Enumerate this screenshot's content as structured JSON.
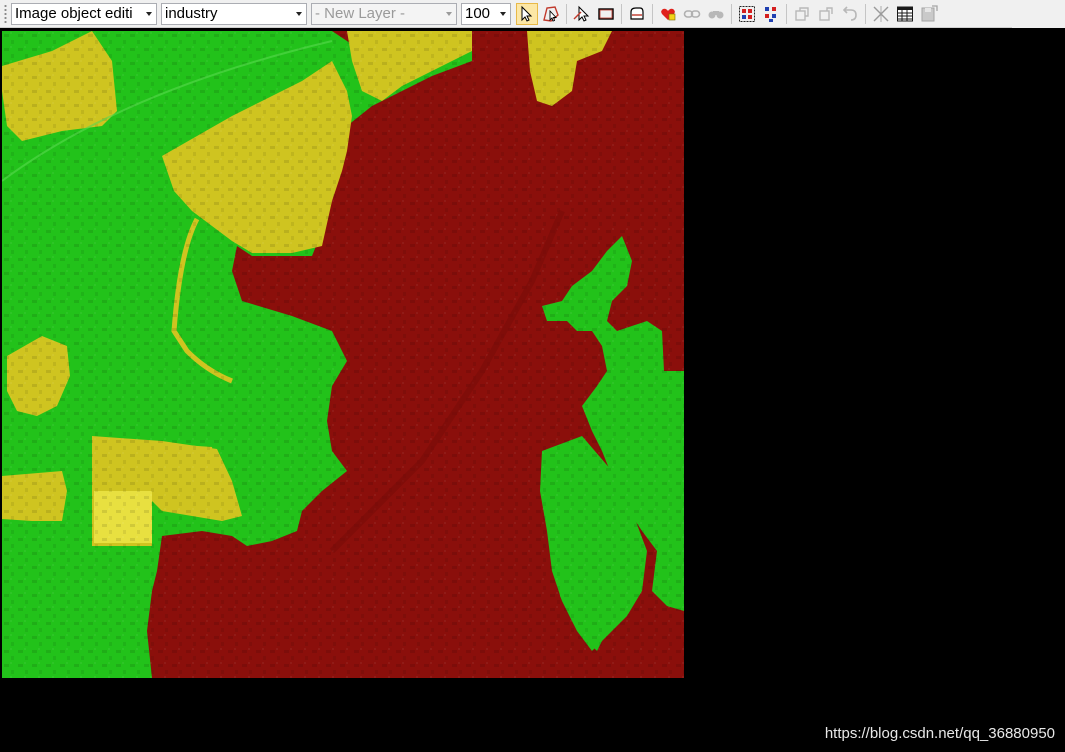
{
  "toolbar": {
    "mode_combo": {
      "value": "Image object editi"
    },
    "class_combo": {
      "value": "industry"
    },
    "layer_combo": {
      "value": "- New Layer -"
    },
    "level_combo": {
      "value": "100"
    }
  },
  "legend_colors": {
    "industry": "#8b0f0b",
    "vegetation": "#22c21a",
    "bare": "#cfc420"
  },
  "watermark": "https://blog.csdn.net/qq_36880950"
}
